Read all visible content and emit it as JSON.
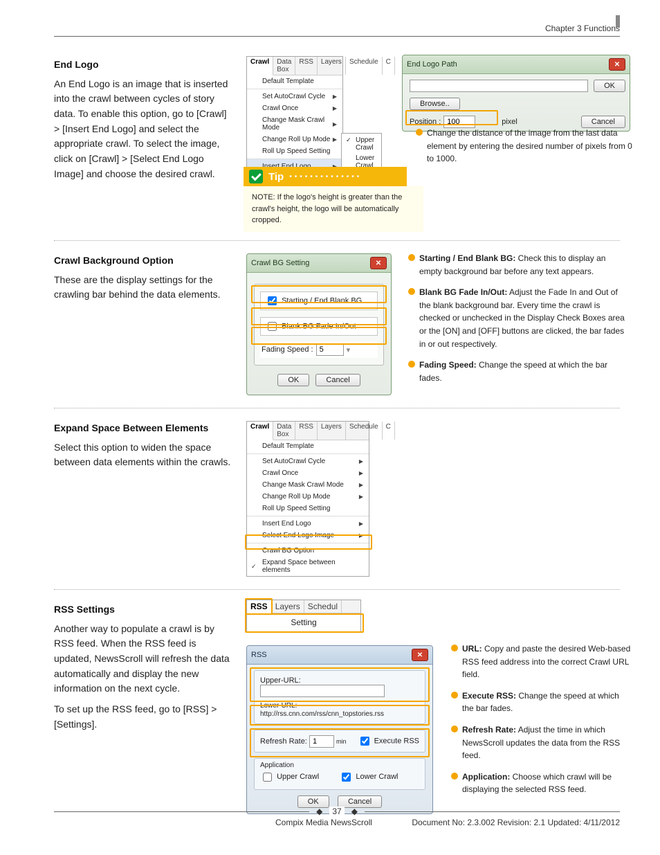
{
  "header": {
    "chapter": "Chapter 3 Functions"
  },
  "sections": {
    "endlogo": {
      "title": "End Logo",
      "para": "An End Logo is an image that is inserted into the crawl between cycles of story data. To enable this option, go to [Crawl] > [Insert End Logo] and select the appropriate crawl. To select the image, click on [Crawl] > [Select End Logo Image] and choose the desired crawl."
    },
    "crawlbg": {
      "title": "Crawl Background Option",
      "para": "These are the display settings for the crawling bar behind the data elements."
    },
    "expand": {
      "title": "Expand Space Between Elements",
      "para": "Select this option to widen the space between data elements within the crawls."
    },
    "rss": {
      "title": "RSS Settings",
      "para1": "Another way to populate a crawl is by RSS feed. When the RSS feed is updated, NewsScroll will refresh the data automatically and display the new information on the next cycle.",
      "para2": "To set up the RSS feed, go to [RSS] > [Settings]."
    }
  },
  "menu1": {
    "tabs": [
      "Crawl",
      "Data Box",
      "RSS",
      "Layers",
      "Schedule",
      "C"
    ],
    "items": [
      {
        "label": "Default Template"
      },
      {
        "label": "Set AutoCrawl Cycle",
        "arrow": true,
        "sep": true
      },
      {
        "label": "Crawl Once",
        "arrow": true
      },
      {
        "label": "Change Mask Crawl Mode",
        "arrow": true
      },
      {
        "label": "Change Roll Up Mode",
        "arrow": true
      },
      {
        "label": "Roll Up Speed Setting"
      },
      {
        "label": "Insert End Logo",
        "arrow": true,
        "sep": true,
        "hover": true
      },
      {
        "label": "Select End Logo Image",
        "arrow": true
      },
      {
        "label": "Crawl BG Option",
        "sep": true
      },
      {
        "label": "Expand Space between elements",
        "check": true
      }
    ],
    "sub": [
      {
        "label": "Upper Crawl",
        "check": true
      },
      {
        "label": "Lower Crawl"
      }
    ]
  },
  "endlogodlg": {
    "title": "End Logo Path",
    "browse": "Browse..",
    "ok": "OK",
    "cancel": "Cancel",
    "pos_label": "Position :",
    "pos_val": "100",
    "pos_unit": "pixel"
  },
  "endlogo_callout": "Change the distance of the image from the last data element by entering the desired number of pixels from 0 to 1000.",
  "tip": {
    "label": "Tip",
    "note": "NOTE: If the logo's height is greater than the crawl's height, the logo will be automatically cropped."
  },
  "bgdlg": {
    "title": "Crawl BG Setting",
    "cb1": "Starting / End Blank BG",
    "cb2": "Blank BG Fade In/Out",
    "fspeed_label": "Fading Speed :",
    "fspeed_val": "5",
    "ok": "OK",
    "cancel": "Cancel"
  },
  "bg_callouts": {
    "c1_b": "Starting / End Blank BG:",
    "c1": " Check this to display an empty background bar before any text appears.",
    "c2_b": "Blank BG Fade In/Out:",
    "c2": " Adjust the Fade In and Out of the blank background bar. Every time the crawl is checked or unchecked in the Display Check Boxes area or the [ON] and [OFF] buttons are clicked, the bar fades in or out respectively.",
    "c3_b": "Fading Speed:",
    "c3": " Change the speed at which the bar fades."
  },
  "menu2": {
    "tabs": [
      "Crawl",
      "Data Box",
      "RSS",
      "Layers",
      "Schedule",
      "C"
    ],
    "items": [
      {
        "label": "Default Template"
      },
      {
        "label": "Set AutoCrawl Cycle",
        "arrow": true,
        "sep": true
      },
      {
        "label": "Crawl Once",
        "arrow": true
      },
      {
        "label": "Change Mask Crawl Mode",
        "arrow": true
      },
      {
        "label": "Change Roll Up Mode",
        "arrow": true
      },
      {
        "label": "Roll Up Speed Setting"
      },
      {
        "label": "Insert End Logo",
        "arrow": true,
        "sep": true
      },
      {
        "label": "Select End Logo Image",
        "arrow": true
      },
      {
        "label": "Crawl BG Option",
        "sep": true
      },
      {
        "label": "Expand Space between elements",
        "check": true
      }
    ]
  },
  "rssmenu": {
    "tabs": [
      "RSS",
      "Layers",
      "Schedul"
    ],
    "item": "Setting"
  },
  "rssdlg": {
    "title": "RSS",
    "upper": "Upper-URL:",
    "lower": "Lower-URL: http://rss.cnn.com/rss/cnn_topstories.rss",
    "refresh_label": "Refresh Rate:",
    "refresh_val": "1",
    "refresh_unit": "min",
    "exec": "Execute RSS",
    "app_label": "Application",
    "app_upper": "Upper Crawl",
    "app_lower": "Lower Crawl",
    "ok": "OK",
    "cancel": "Cancel"
  },
  "rss_callouts": {
    "c1_b": "URL:",
    "c1": " Copy and paste the desired Web-based RSS feed address into the correct Crawl URL field.",
    "c2_b": "Execute RSS:",
    "c2": " Change the speed at which the bar fades.",
    "c3_b": "Refresh Rate:",
    "c3": " Adjust the time in which NewsScroll updates the data from the RSS feed.",
    "c4_b": "Application:",
    "c4": " Choose which crawl will be displaying the selected RSS feed."
  },
  "footer": {
    "page": "37",
    "left": "Compix Media NewsScroll",
    "right": "Document No: 2.3.002 Revision: 2.1 Updated: 4/11/2012"
  }
}
